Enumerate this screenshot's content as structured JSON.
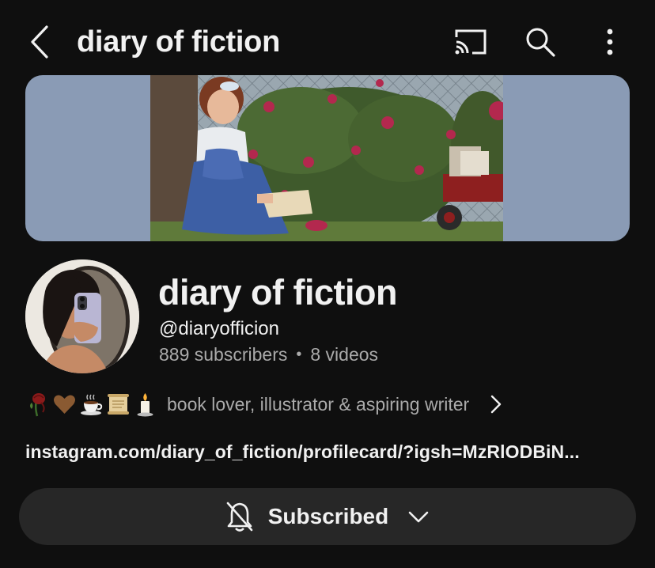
{
  "header": {
    "title": "diary of fiction",
    "back_icon": "chevron-left-icon",
    "cast_icon": "cast-icon",
    "search_icon": "search-icon",
    "more_icon": "more-vertical-icon"
  },
  "banner": {
    "image": "girl-reading-book-in-garden"
  },
  "channel": {
    "name": "diary of fiction",
    "handle": "@diaryofficion",
    "subscribers": "889 subscribers",
    "separator": "•",
    "videos": "8 videos",
    "avatar": "person-mirror-selfie"
  },
  "description": {
    "emojis": [
      "wilted-rose",
      "brown-heart",
      "hot-beverage",
      "scroll",
      "candle"
    ],
    "text": "book lover, illustrator & aspiring writer"
  },
  "link": "instagram.com/diary_of_fiction/profilecard/?igsh=MzRlODBiN...",
  "subscribe": {
    "label": "Subscribed",
    "icon": "bell-off-icon",
    "dropdown_icon": "chevron-down-icon"
  },
  "colors": {
    "background": "#0f0f0f",
    "banner": "#8a9bb5",
    "button": "#272727",
    "secondary_text": "#aaaaaa"
  }
}
